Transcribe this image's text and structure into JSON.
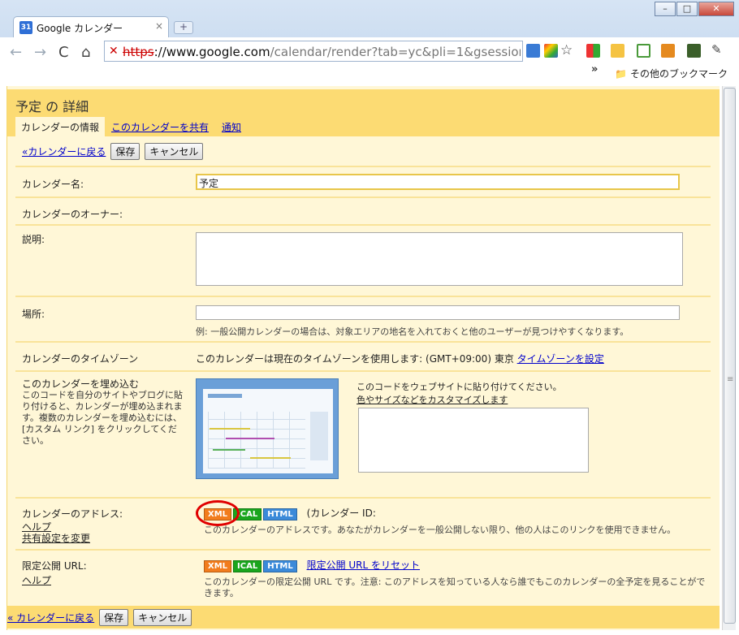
{
  "browser": {
    "tab_title": "Google カレンダー",
    "tab_icon_text": "31",
    "url_proto": "https",
    "url_host": "://www.google.com",
    "url_path": "/calendar/render?tab=yc&pli=1&gsessioni",
    "bookmarks_label": "その他のブックマーク"
  },
  "page": {
    "title": "予定 の 詳細",
    "tabs": [
      "カレンダーの情報",
      "このカレンダーを共有",
      "通知"
    ],
    "back_link": "«カレンダーに戻る",
    "back_link_bottom": "« カレンダーに戻る",
    "save": "保存",
    "cancel": "キャンセル"
  },
  "fields": {
    "name_label": "カレンダー名:",
    "name_value": "予定",
    "owner_label": "カレンダーのオーナー:",
    "desc_label": "説明:",
    "location_label": "場所:",
    "location_hint": "例: 一般公開カレンダーの場合は、対象エリアの地名を入れておくと他のユーザーが見つけやすくなります。",
    "tz_label": "カレンダーのタイムゾーン",
    "tz_text": "このカレンダーは現在のタイムゾーンを使用します:  (GMT+09:00) 東京",
    "tz_link": "タイムゾーンを設定",
    "embed_label": "このカレンダーを埋め込む",
    "embed_desc": "このコードを自分のサイトやブログに貼り付けると、カレンダーが埋め込まれます。複数のカレンダーを埋め込むには、[カスタム リンク] をクリックしてください。",
    "embed_paste": "このコードをウェブサイトに貼り付けてください。",
    "embed_customize": "色やサイズなどをカスタマイズします",
    "address_label": "カレンダーのアドレス:",
    "address_help": "ヘルプ",
    "address_share": "共有設定を変更",
    "calendar_id": "(カレンダー ID:",
    "address_note": "このカレンダーのアドレスです。あなたがカレンダーを一般公開しない限り、他の人はこのリンクを使用できません。",
    "private_label": "限定公開 URL:",
    "private_help": "ヘルプ",
    "private_reset": "限定公開 URL をリセット",
    "private_note": "このカレンダーの限定公開 URL です。注意: このアドレスを知っている人なら誰でもこのカレンダーの全予定を見ることができます。"
  },
  "badges": {
    "xml": "XML",
    "ical": "ICAL",
    "html": "HTML"
  },
  "colors": {
    "header": "#fcdb73",
    "panel": "#fff7d7",
    "accent_red": "#e00000"
  }
}
